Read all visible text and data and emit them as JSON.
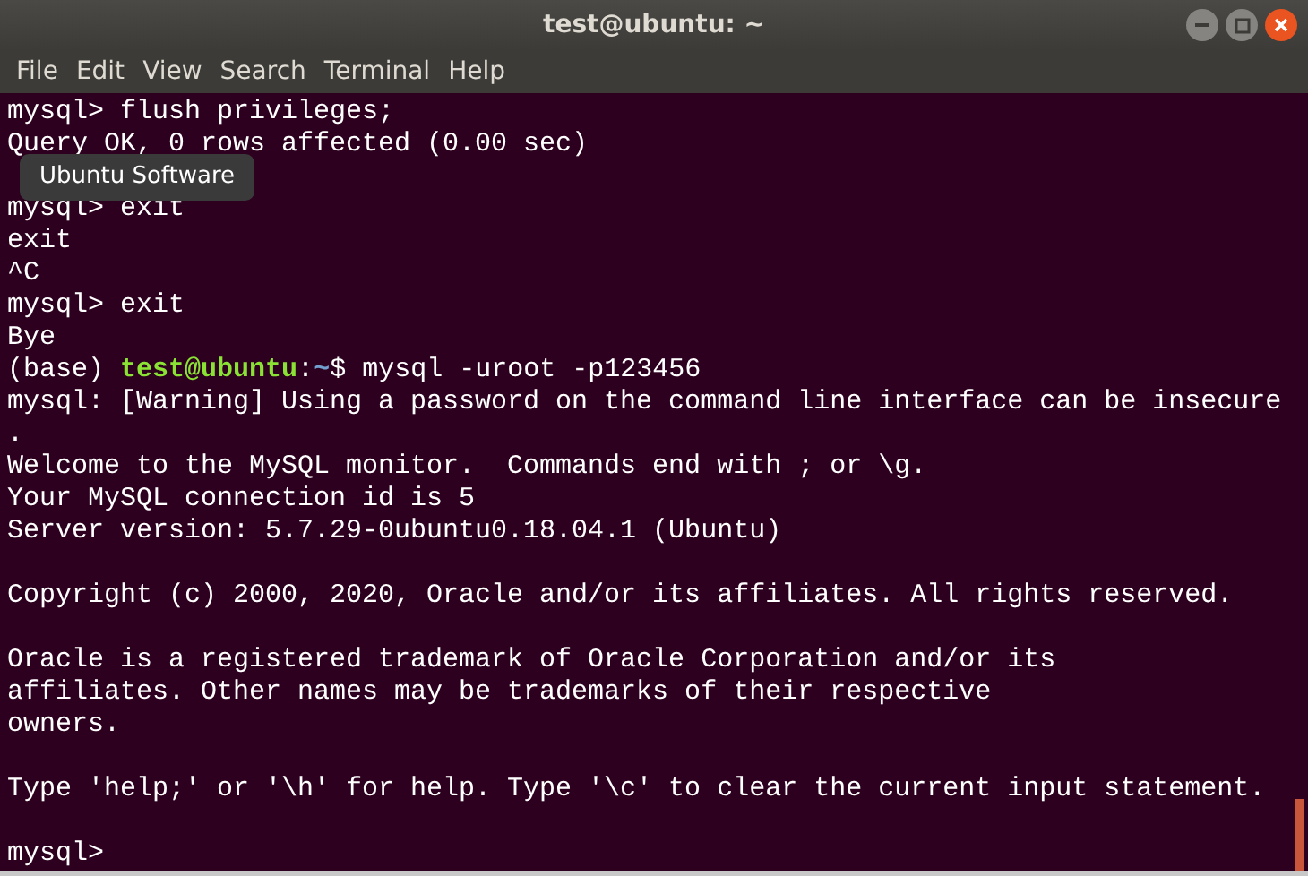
{
  "window": {
    "title": "test@ubuntu: ~"
  },
  "menu": [
    "File",
    "Edit",
    "View",
    "Search",
    "Terminal",
    "Help"
  ],
  "tooltip": {
    "text": "Ubuntu Software"
  },
  "terminal": {
    "lines": [
      {
        "kind": "text",
        "segments": [
          {
            "kind": "plain",
            "text": "mysql> flush privileges;"
          }
        ]
      },
      {
        "kind": "text",
        "segments": [
          {
            "kind": "plain",
            "text": "Query OK, 0 rows affected (0.00 sec)"
          }
        ]
      },
      {
        "kind": "blank"
      },
      {
        "kind": "text",
        "segments": [
          {
            "kind": "plain",
            "text": "mysql> exit"
          }
        ]
      },
      {
        "kind": "text",
        "segments": [
          {
            "kind": "plain",
            "text": "exit"
          }
        ]
      },
      {
        "kind": "text",
        "segments": [
          {
            "kind": "plain",
            "text": "^C"
          }
        ]
      },
      {
        "kind": "text",
        "segments": [
          {
            "kind": "plain",
            "text": "mysql> exit"
          }
        ]
      },
      {
        "kind": "text",
        "segments": [
          {
            "kind": "plain",
            "text": "Bye"
          }
        ]
      },
      {
        "kind": "text",
        "segments": [
          {
            "kind": "plain",
            "text": "(base) "
          },
          {
            "kind": "user",
            "text": "test@ubuntu"
          },
          {
            "kind": "plain",
            "text": ":"
          },
          {
            "kind": "path",
            "text": "~"
          },
          {
            "kind": "plain",
            "text": "$ mysql -uroot -p123456"
          }
        ]
      },
      {
        "kind": "text",
        "segments": [
          {
            "kind": "plain",
            "text": "mysql: [Warning] Using a password on the command line interface can be insecure"
          }
        ]
      },
      {
        "kind": "text",
        "segments": [
          {
            "kind": "plain",
            "text": "."
          }
        ]
      },
      {
        "kind": "text",
        "segments": [
          {
            "kind": "plain",
            "text": "Welcome to the MySQL monitor.  Commands end with ; or \\g."
          }
        ]
      },
      {
        "kind": "text",
        "segments": [
          {
            "kind": "plain",
            "text": "Your MySQL connection id is 5"
          }
        ]
      },
      {
        "kind": "text",
        "segments": [
          {
            "kind": "plain",
            "text": "Server version: 5.7.29-0ubuntu0.18.04.1 (Ubuntu)"
          }
        ]
      },
      {
        "kind": "blank"
      },
      {
        "kind": "text",
        "segments": [
          {
            "kind": "plain",
            "text": "Copyright (c) 2000, 2020, Oracle and/or its affiliates. All rights reserved."
          }
        ]
      },
      {
        "kind": "blank"
      },
      {
        "kind": "text",
        "segments": [
          {
            "kind": "plain",
            "text": "Oracle is a registered trademark of Oracle Corporation and/or its"
          }
        ]
      },
      {
        "kind": "text",
        "segments": [
          {
            "kind": "plain",
            "text": "affiliates. Other names may be trademarks of their respective"
          }
        ]
      },
      {
        "kind": "text",
        "segments": [
          {
            "kind": "plain",
            "text": "owners."
          }
        ]
      },
      {
        "kind": "blank"
      },
      {
        "kind": "text",
        "segments": [
          {
            "kind": "plain",
            "text": "Type 'help;' or '\\h' for help. Type '\\c' to clear the current input statement."
          }
        ]
      },
      {
        "kind": "blank"
      },
      {
        "kind": "text",
        "segments": [
          {
            "kind": "plain",
            "text": "mysql> "
          }
        ]
      }
    ]
  }
}
